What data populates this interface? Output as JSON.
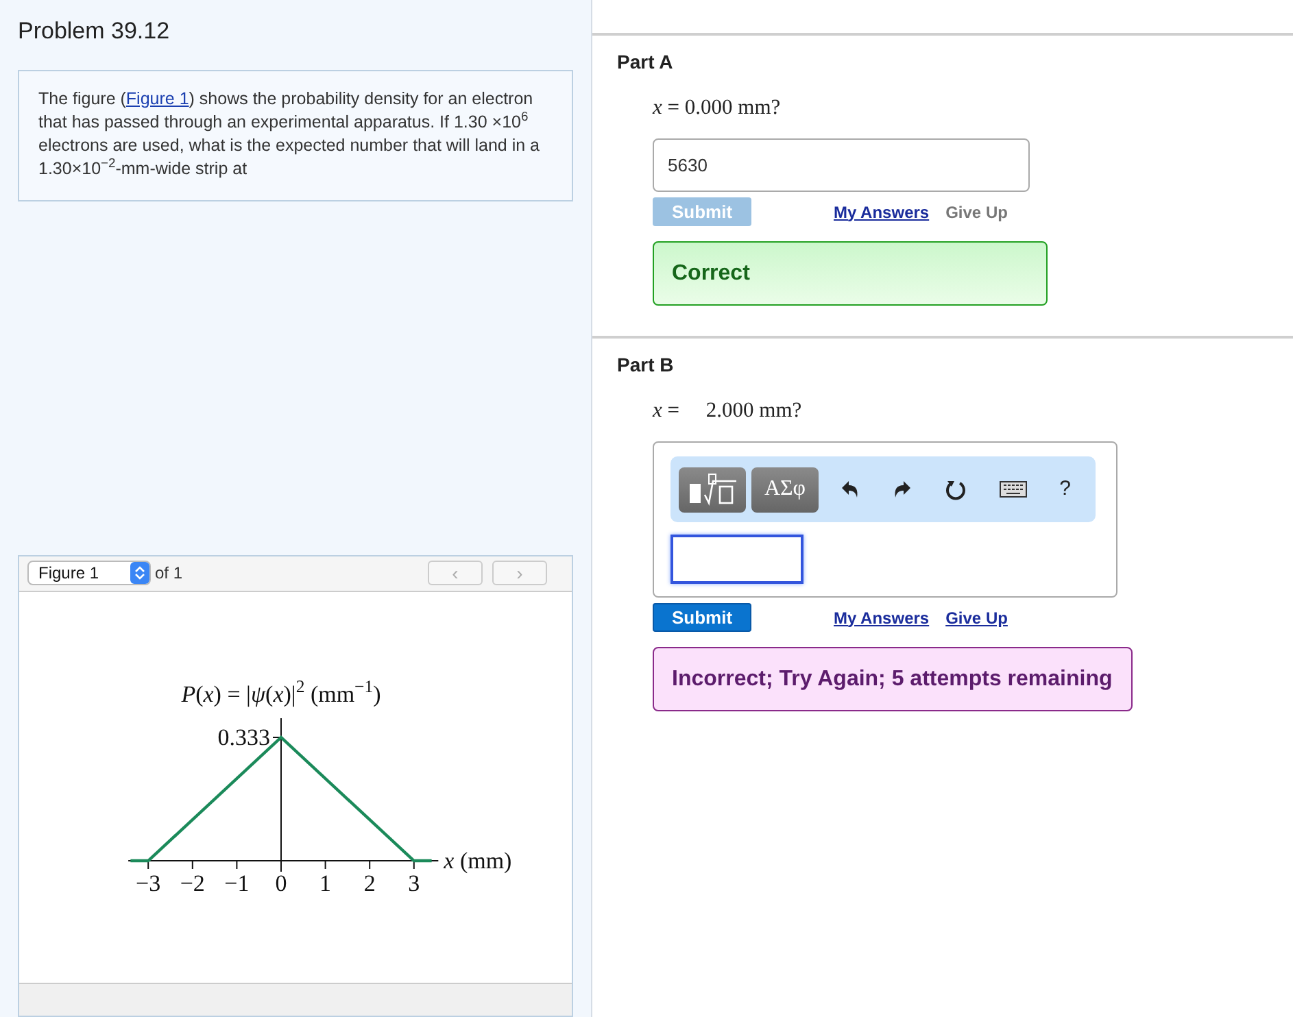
{
  "problem": {
    "title": "Problem 39.12",
    "text_before": "The figure (",
    "link": "Figure 1",
    "text_after": ") shows the probability density for an electron that has passed through an experimental apparatus. If 1.30 ×10$^{6}$ electrons are used, what is the expected number that will land in a 1.30×10$^{−2}$-mm-wide strip at"
  },
  "figure": {
    "select": "Figure 1",
    "of": "of 1",
    "prev": "‹",
    "next": "›",
    "graph": {
      "title": "*P*(*x*) = |*ψ*(*x*)|$^{2}$ (mm$^{−1}$)",
      "x_axis_label": "*x* (mm)",
      "peak_label": "0.333",
      "x_tick_labels": [
        "−3",
        "−2",
        "−1",
        "0",
        "1",
        "2",
        "3"
      ]
    }
  },
  "parts": [
    {
      "title": "Part A",
      "question": "*x* = 0.000 mm?",
      "kind": "text",
      "answer": "5630",
      "submit": "Submit",
      "submit_disabled": true,
      "my_answers": "My Answers",
      "give_up": "Give Up",
      "give_up_disabled": true,
      "feedback": {
        "kind": "correct",
        "text": "Correct"
      }
    },
    {
      "title": "Part B",
      "question": "*x* =     2.000 mm?",
      "kind": "math",
      "symbols": "ΑΣφ",
      "help": "?",
      "submit": "Submit",
      "submit_disabled": false,
      "my_answers": "My Answers",
      "give_up": "Give Up",
      "give_up_disabled": false,
      "feedback": {
        "kind": "incorrect",
        "text": "Incorrect; Try Again; 5 attempts remaining"
      }
    }
  ]
}
